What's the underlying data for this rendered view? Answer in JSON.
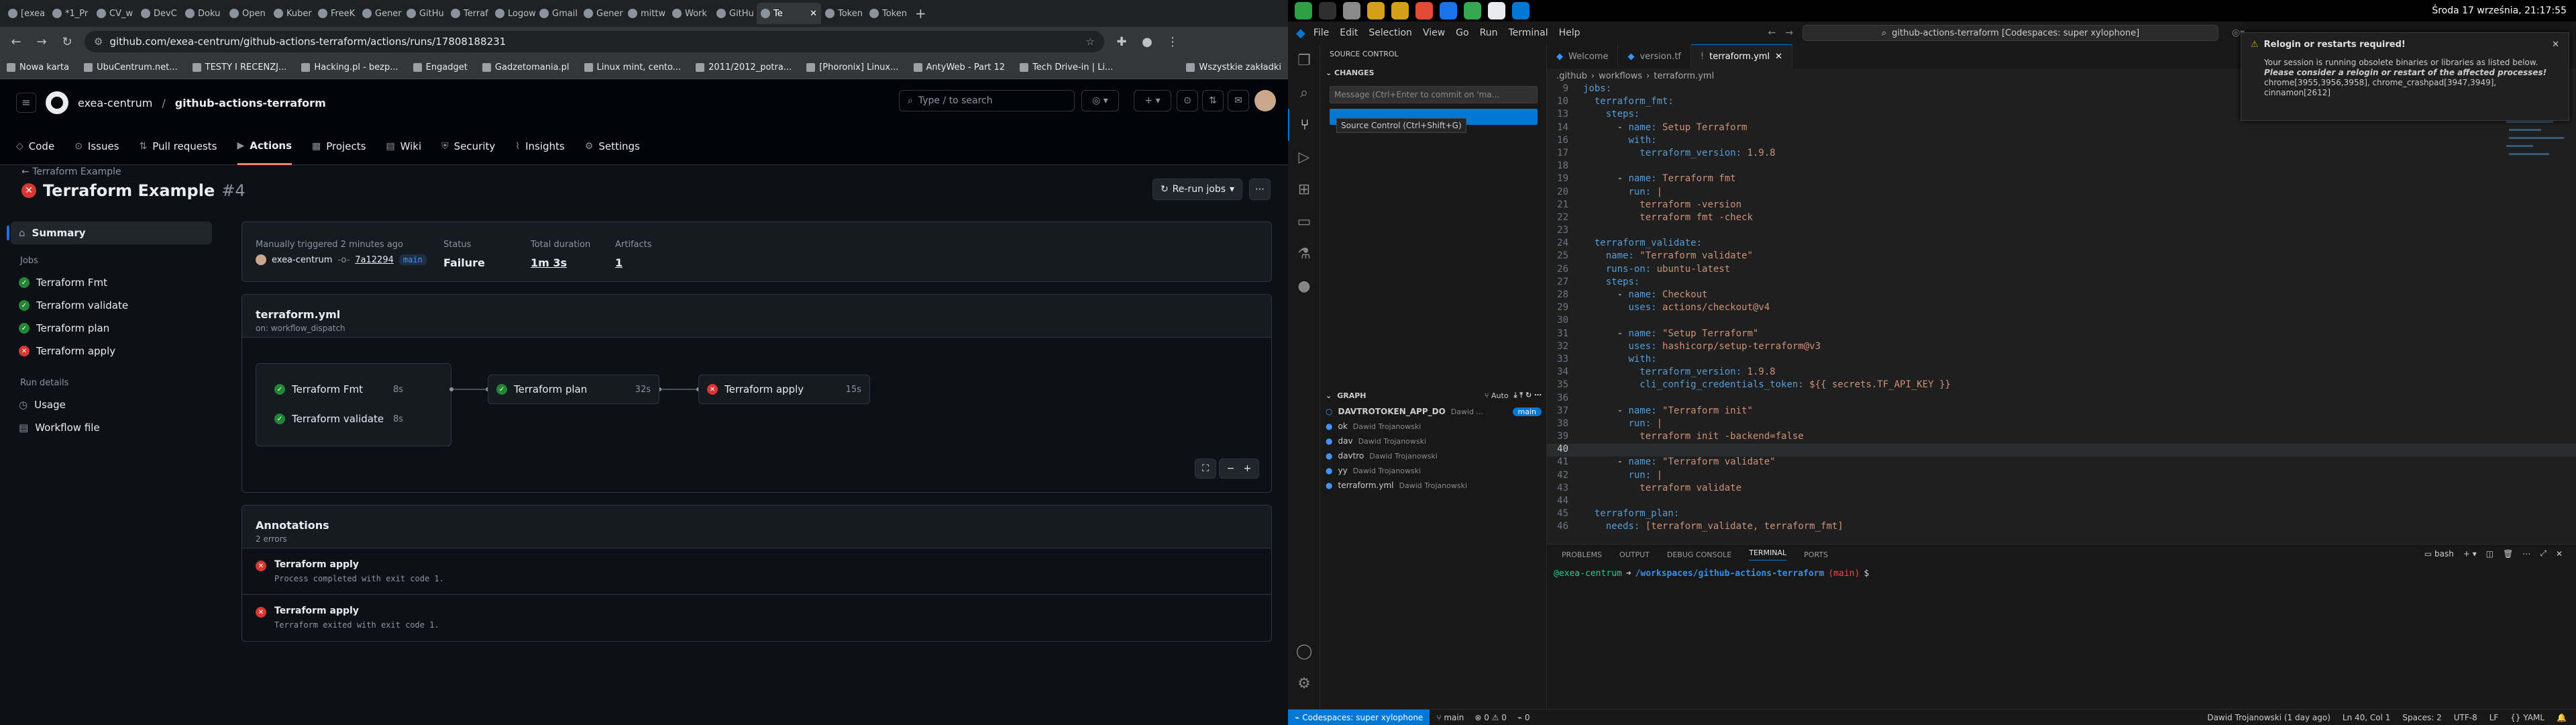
{
  "browser": {
    "tabs": [
      "[exea",
      "*1_Pr",
      "CV_w",
      "DevC",
      "Doku",
      "Open",
      "Kuber",
      "FreeK",
      "Gener",
      "GitHu",
      "Terraf",
      "Logow",
      "Gmail",
      "Gener",
      "mittw",
      "Work",
      "GitHu",
      "Te",
      "Token",
      "Token"
    ],
    "active_tab_index": 17,
    "url": "github.com/exea-centrum/github-actions-terraform/actions/runs/17808188231",
    "bookmarks": [
      "Nowa karta",
      "UbuCentrum.net...",
      "TESTY I RECENZJ...",
      "Hacking.pl - bezp...",
      "Engadget",
      "Gadzetomania.pl",
      "Linux mint, cento...",
      "2011/2012_potra...",
      "[Phoronix] Linux...",
      "AntyWeb - Part 12",
      "Tech Drive-in | Li..."
    ],
    "bookmarks_all": "Wszystkie zakładki"
  },
  "github": {
    "owner": "exea-centrum",
    "repo": "github-actions-terraform",
    "search_placeholder": "Type / to search",
    "nav": [
      "Code",
      "Issues",
      "Pull requests",
      "Actions",
      "Projects",
      "Wiki",
      "Security",
      "Insights",
      "Settings"
    ],
    "back_link": "Terraform Example",
    "run_title": "Terraform Example",
    "run_number": "#4",
    "rerun_label": "Re-run jobs",
    "sidebar": {
      "summary": "Summary",
      "jobs_header": "Jobs",
      "jobs": [
        {
          "name": "Terraform Fmt",
          "status": "success"
        },
        {
          "name": "Terraform validate",
          "status": "success"
        },
        {
          "name": "Terraform plan",
          "status": "success"
        },
        {
          "name": "Terraform apply",
          "status": "failure"
        }
      ],
      "run_details_header": "Run details",
      "run_details": [
        "Usage",
        "Workflow file"
      ]
    },
    "summary": {
      "trigger_text": "Manually triggered 2 minutes ago",
      "actor": "exea-centrum",
      "commit": "7a12294",
      "branch": "main",
      "status_label": "Status",
      "status_value": "Failure",
      "duration_label": "Total duration",
      "duration_value": "1m 3s",
      "artifacts_label": "Artifacts",
      "artifacts_value": "1"
    },
    "workflow": {
      "file": "terraform.yml",
      "trigger": "on: workflow_dispatch",
      "jobs": [
        {
          "name": "Terraform Fmt",
          "duration": "8s",
          "status": "success"
        },
        {
          "name": "Terraform validate",
          "duration": "8s",
          "status": "success"
        },
        {
          "name": "Terraform plan",
          "duration": "32s",
          "status": "success"
        },
        {
          "name": "Terraform apply",
          "duration": "15s",
          "status": "failure"
        }
      ]
    },
    "annotations": {
      "title": "Annotations",
      "count": "2 errors",
      "items": [
        {
          "job": "Terraform apply",
          "message": "Process completed with exit code 1."
        },
        {
          "job": "Terraform apply",
          "message": "Terraform exited with exit code 1."
        }
      ]
    }
  },
  "desktop": {
    "datetime": "Środa 17 września, 21:17:55"
  },
  "vscode": {
    "menu": [
      "File",
      "Edit",
      "Selection",
      "View",
      "Go",
      "Run",
      "Terminal",
      "Help"
    ],
    "command_center": "github-actions-terraform [Codespaces: super xylophone]",
    "source_control": {
      "title": "SOURCE CONTROL",
      "changes": "CHANGES",
      "message_placeholder": "Message (Ctrl+Enter to commit on 'ma...",
      "tooltip": "Source Control (Ctrl+Shift+G)",
      "graph_title": "GRAPH",
      "graph_auto": "Auto",
      "graph_entries": [
        {
          "message": "DAVTROTOKEN_APP_DO",
          "author": "Dawid ...",
          "badge": "main"
        },
        {
          "message": "ok",
          "author": "Dawid Trojanowski"
        },
        {
          "message": "dav",
          "author": "Dawid Trojanowski"
        },
        {
          "message": "davtro",
          "author": "Dawid Trojanowski"
        },
        {
          "message": "yy",
          "author": "Dawid Trojanowski"
        },
        {
          "message": "terraform.yml",
          "author": "Dawid Trojanowski"
        }
      ]
    },
    "tabs": [
      "Welcome",
      "version.tf",
      "terraform.yml"
    ],
    "active_tab": "terraform.yml",
    "breadcrumb": [
      ".github",
      "workflows",
      "terraform.yml"
    ],
    "code": [
      {
        "n": "9",
        "t": "jobs:"
      },
      {
        "n": "10",
        "t": "  terraform_fmt:"
      },
      {
        "n": "13",
        "t": "    steps:"
      },
      {
        "n": "14",
        "t": "      - name: Setup Terraform"
      },
      {
        "n": "16",
        "t": "        with:"
      },
      {
        "n": "17",
        "t": "          terraform_version: 1.9.8"
      },
      {
        "n": "18",
        "t": ""
      },
      {
        "n": "19",
        "t": "      - name: Terraform fmt"
      },
      {
        "n": "20",
        "t": "        run: |"
      },
      {
        "n": "21",
        "t": "          terraform -version"
      },
      {
        "n": "22",
        "t": "          terraform fmt -check"
      },
      {
        "n": "23",
        "t": ""
      },
      {
        "n": "24",
        "t": "  terraform_validate:"
      },
      {
        "n": "25",
        "t": "    name: \"Terraform validate\""
      },
      {
        "n": "26",
        "t": "    runs-on: ubuntu-latest"
      },
      {
        "n": "27",
        "t": "    steps:"
      },
      {
        "n": "28",
        "t": "      - name: Checkout"
      },
      {
        "n": "29",
        "t": "        uses: actions/checkout@v4"
      },
      {
        "n": "30",
        "t": ""
      },
      {
        "n": "31",
        "t": "      - name: \"Setup Terraform\""
      },
      {
        "n": "32",
        "t": "        uses: hashicorp/setup-terraform@v3"
      },
      {
        "n": "33",
        "t": "        with:"
      },
      {
        "n": "34",
        "t": "          terraform_version: 1.9.8"
      },
      {
        "n": "35",
        "t": "          cli_config_credentials_token: ${{ secrets.TF_API_KEY }}"
      },
      {
        "n": "36",
        "t": ""
      },
      {
        "n": "37",
        "t": "      - name: \"Terraform init\""
      },
      {
        "n": "38",
        "t": "        run: |"
      },
      {
        "n": "39",
        "t": "          terraform init -backend=false"
      },
      {
        "n": "40",
        "t": ""
      },
      {
        "n": "41",
        "t": "      - name: \"Terraform validate\""
      },
      {
        "n": "42",
        "t": "        run: |"
      },
      {
        "n": "43",
        "t": "          terraform validate"
      },
      {
        "n": "44",
        "t": ""
      },
      {
        "n": "45",
        "t": "  terraform_plan:"
      },
      {
        "n": "46",
        "t": "    needs: [terraform_validate, terraform_fmt]"
      }
    ],
    "panel_tabs": [
      "PROBLEMS",
      "OUTPUT",
      "DEBUG CONSOLE",
      "TERMINAL",
      "PORTS"
    ],
    "active_panel_tab": "TERMINAL",
    "terminal_shell": "bash",
    "terminal_prompt": {
      "user": "@exea-centrum",
      "arrow": "➜",
      "path": "/workspaces/github-actions-terraform",
      "branch": "(main)",
      "symbol": "$"
    },
    "notification": {
      "title": "Relogin or restarts required!",
      "line1": "Your session is running obsolete binaries or libraries as listed below.",
      "line2": "Please consider a relogin or restart of the affected processes!",
      "line3": "chrome[3955,3956,3958], chrome_crashpad[3947,3949],",
      "line4": "cinnamon[2612]"
    },
    "status": {
      "remote": "Codespaces: super xylophone",
      "branch": "main",
      "problems": "0 ⚠ 0",
      "ports": "0",
      "blame": "Dawid Trojanowski (1 day ago)",
      "cursor": "Ln 40, Col 1",
      "spaces": "Spaces: 2",
      "encoding": "UTF-8",
      "eol": "LF",
      "language": "YAML"
    }
  }
}
